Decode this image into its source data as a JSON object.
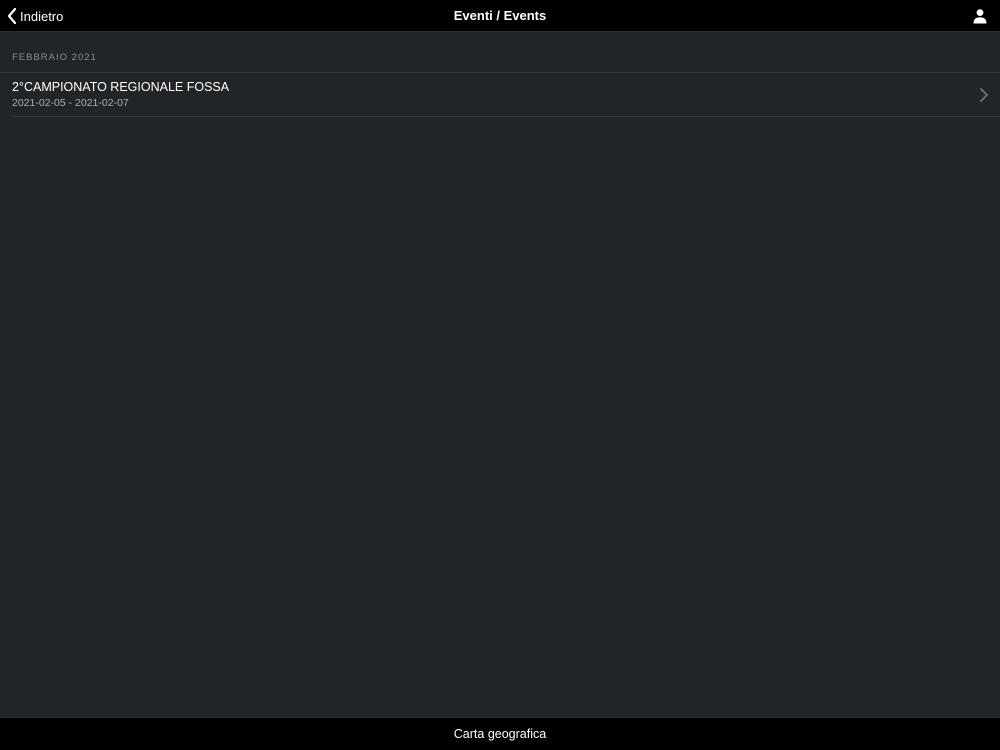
{
  "navbar": {
    "back_label": "Indietro",
    "title": "Eventi / Events",
    "back_icon": "chevron-left-icon",
    "profile_icon": "user-icon"
  },
  "events": {
    "section_header": "FEBBRAIO 2021",
    "items": [
      {
        "title": "2°CAMPIONATO REGIONALE FOSSA",
        "dates": "2021-02-05 - 2021-02-07"
      }
    ],
    "row_icon": "chevron-right-icon"
  },
  "bottom_bar": {
    "label": "Carta geografica"
  },
  "colors": {
    "background": "#222528",
    "bar_background": "#000000",
    "primary_text": "#ffffff",
    "secondary_text": "#a9acb0",
    "section_header_text": "#8a8d91"
  }
}
